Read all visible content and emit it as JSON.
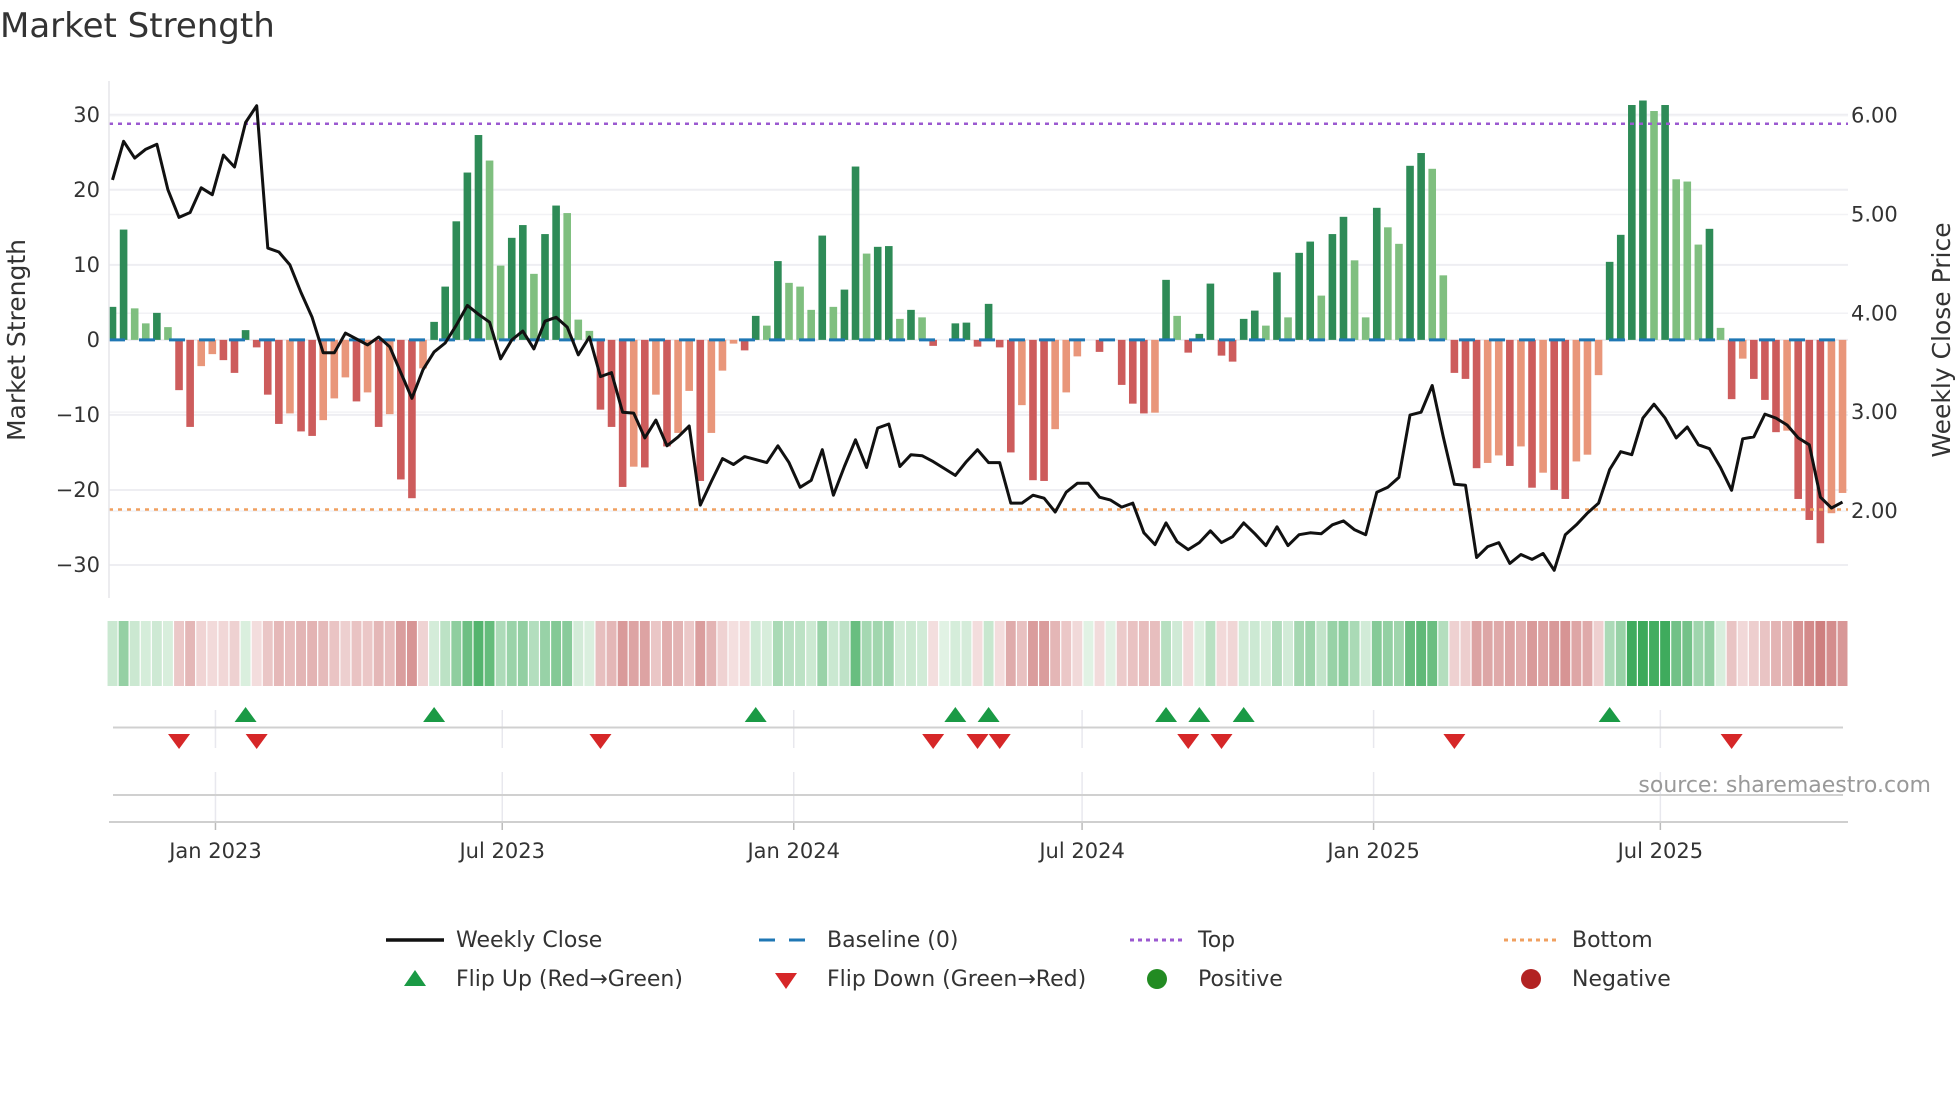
{
  "title": "Market Strength",
  "source": "source: sharemaestro.com",
  "legend": {
    "weekly_close": "Weekly Close",
    "baseline": "Baseline (0)",
    "top": "Top",
    "bottom": "Bottom",
    "flip_up": "Flip Up (Red→Green)",
    "flip_down": "Flip Down (Green→Red)",
    "positive": "Positive",
    "negative": "Negative"
  },
  "colors": {
    "pos_strong": "#2e8b57",
    "pos_weak": "#7fbf7f",
    "neg_strong": "#cd5c5c",
    "neg_weak": "#e9967a",
    "baseline": "#1f77b4",
    "top": "#9b59d0",
    "bottom": "#f0a060",
    "line": "#111111",
    "flip_up": "#1a9a45",
    "flip_down": "#d62728",
    "positive": "#228b22",
    "negative": "#b22222"
  },
  "chart_data": {
    "type": "bar+line",
    "title": "Market Strength",
    "ylabel": "Market Strength",
    "ylabel_right": "Weekly Close Price",
    "ylim": [
      -34.4,
      34.5
    ],
    "ylim_right": [
      1.12,
      6.35
    ],
    "yticks": [
      30,
      20,
      10,
      0,
      -10,
      -20,
      -30
    ],
    "ytick_labels": [
      "30",
      "20",
      "10",
      "0",
      "−10",
      "−20",
      "−30"
    ],
    "yticks_right": [
      6,
      5,
      4,
      3,
      2
    ],
    "ytick_right_labels": [
      "6.00",
      "5.00",
      "4.00",
      "3.00",
      "2.00"
    ],
    "x_start": "2022-10-28",
    "x_interval_days": 7,
    "xticks": [
      {
        "date": "2023-01-01",
        "label": "Jan 2023"
      },
      {
        "date": "2023-07-01",
        "label": "Jul 2023"
      },
      {
        "date": "2024-01-01",
        "label": "Jan 2024"
      },
      {
        "date": "2024-07-01",
        "label": "Jul 2024"
      },
      {
        "date": "2025-01-01",
        "label": "Jan 2025"
      },
      {
        "date": "2025-07-01",
        "label": "Jul 2025"
      }
    ],
    "top_level": 28.8,
    "bottom_level": -22.6,
    "baseline": 0,
    "strength": [
      4.4,
      14.7,
      4.2,
      2.2,
      3.6,
      1.7,
      -6.7,
      -11.6,
      -3.5,
      -1.9,
      -2.7,
      -4.4,
      1.3,
      -1.0,
      -7.3,
      -11.2,
      -9.8,
      -12.2,
      -12.8,
      -10.7,
      -7.8,
      -5.0,
      -8.2,
      -7.0,
      -11.6,
      -9.9,
      -18.6,
      -21.1,
      -3.8,
      2.4,
      7.1,
      15.8,
      22.3,
      27.3,
      23.9,
      9.9,
      13.6,
      15.3,
      8.8,
      14.1,
      17.9,
      16.9,
      2.7,
      1.2,
      -9.3,
      -11.6,
      -19.6,
      -16.9,
      -17.0,
      -7.3,
      -14.2,
      -12.4,
      -6.8,
      -18.8,
      -12.4,
      -4.1,
      -0.5,
      -1.4,
      3.2,
      1.9,
      10.5,
      7.6,
      7.1,
      4.0,
      13.9,
      4.4,
      6.7,
      23.1,
      11.5,
      12.4,
      12.5,
      2.8,
      4.0,
      3.0,
      -0.8,
      0,
      2.2,
      2.3,
      -0.9,
      4.8,
      -1.0,
      -15.0,
      -8.7,
      -18.7,
      -18.8,
      -11.9,
      -7.0,
      -2.2,
      0,
      -1.6,
      0,
      -6.0,
      -8.5,
      -9.8,
      -9.7,
      8.0,
      3.2,
      -1.7,
      0.8,
      7.5,
      -2.1,
      -2.9,
      2.8,
      3.9,
      1.9,
      9.0,
      3.0,
      11.6,
      13.1,
      5.9,
      14.1,
      16.4,
      10.6,
      3.0,
      17.6,
      15.0,
      12.8,
      23.2,
      24.9,
      22.8,
      8.6,
      -4.4,
      -5.2,
      -17.1,
      -16.4,
      -15.4,
      -16.8,
      -14.2,
      -19.7,
      -17.7,
      -20.0,
      -21.2,
      -16.2,
      -15.3,
      -4.7,
      10.4,
      14.0,
      31.3,
      31.9,
      30.5,
      31.3,
      21.4,
      21.1,
      12.7,
      14.8,
      1.6,
      -7.9,
      -2.5,
      -5.2,
      -8.0,
      -12.3,
      -12.1,
      -21.2,
      -24.0,
      -27.1,
      -23.1,
      -20.4
    ],
    "weekly_close": [
      5.35,
      5.74,
      5.57,
      5.66,
      5.71,
      5.25,
      4.97,
      5.02,
      5.27,
      5.2,
      5.6,
      5.48,
      5.93,
      6.1,
      4.66,
      4.62,
      4.49,
      4.21,
      3.96,
      3.6,
      3.6,
      3.8,
      3.74,
      3.68,
      3.76,
      3.66,
      3.4,
      3.14,
      3.43,
      3.61,
      3.7,
      3.88,
      4.08,
      3.99,
      3.91,
      3.54,
      3.73,
      3.82,
      3.64,
      3.92,
      3.96,
      3.86,
      3.58,
      3.76,
      3.36,
      3.4,
      3.0,
      2.99,
      2.74,
      2.92,
      2.66,
      2.75,
      2.86,
      2.06,
      2.3,
      2.53,
      2.47,
      2.55,
      2.52,
      2.49,
      2.66,
      2.49,
      2.24,
      2.31,
      2.62,
      2.16,
      2.45,
      2.72,
      2.44,
      2.84,
      2.88,
      2.45,
      2.57,
      2.56,
      2.5,
      2.43,
      2.36,
      2.5,
      2.62,
      2.49,
      2.49,
      2.08,
      2.08,
      2.16,
      2.13,
      1.99,
      2.19,
      2.28,
      2.28,
      2.14,
      2.11,
      2.04,
      2.08,
      1.78,
      1.66,
      1.88,
      1.69,
      1.61,
      1.68,
      1.8,
      1.68,
      1.74,
      1.88,
      1.77,
      1.65,
      1.84,
      1.65,
      1.76,
      1.78,
      1.77,
      1.86,
      1.9,
      1.81,
      1.76,
      2.19,
      2.24,
      2.34,
      2.97,
      3.0,
      3.27,
      2.75,
      2.27,
      2.26,
      1.53,
      1.64,
      1.68,
      1.47,
      1.56,
      1.51,
      1.57,
      1.4,
      1.76,
      1.86,
      1.98,
      2.08,
      2.42,
      2.6,
      2.57,
      2.94,
      3.08,
      2.94,
      2.74,
      2.85,
      2.67,
      2.63,
      2.44,
      2.21,
      2.73,
      2.75,
      2.98,
      2.94,
      2.87,
      2.74,
      2.67,
      2.14,
      2.03,
      2.09
    ],
    "grid": true,
    "legend_position": "bottom"
  }
}
